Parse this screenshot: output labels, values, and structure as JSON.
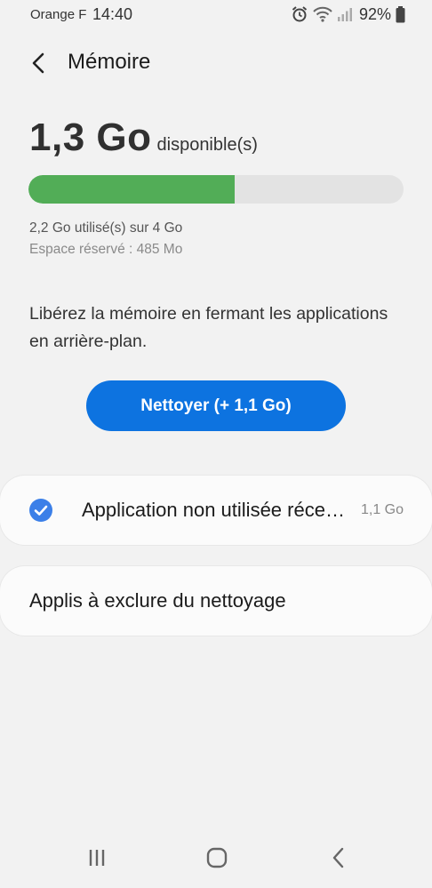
{
  "status": {
    "carrier": "Orange F",
    "time": "14:40",
    "battery": "92%",
    "battery_level": 0.92,
    "icons": [
      "alarm-icon",
      "wifi-icon",
      "signal-icon",
      "battery-icon"
    ]
  },
  "header": {
    "title": "Mémoire"
  },
  "storage": {
    "available_value": "1,3 Go",
    "available_suffix": "disponible(s)",
    "used_text": "2,2 Go utilisé(s) sur 4 Go",
    "reserved_text": "Espace réservé : 485 Mo",
    "usage_fraction": 0.55,
    "bar_color": "#52ad57",
    "bar_track_color": "#e3e3e3"
  },
  "description": "Libérez la mémoire en fermant les applications en arrière-plan.",
  "clean_button": {
    "label": "Nettoyer (+ 1,1 Go)",
    "color": "#0d73e0"
  },
  "items": [
    {
      "label": "Application non utilisée récemment",
      "size": "1,1 Go",
      "checked": true,
      "check_color": "#3b7fe8"
    },
    {
      "label": "Applis à exclure du nettoyage"
    }
  ],
  "navigation": {
    "buttons": [
      "recent-apps-icon",
      "home-icon",
      "back-icon"
    ]
  }
}
